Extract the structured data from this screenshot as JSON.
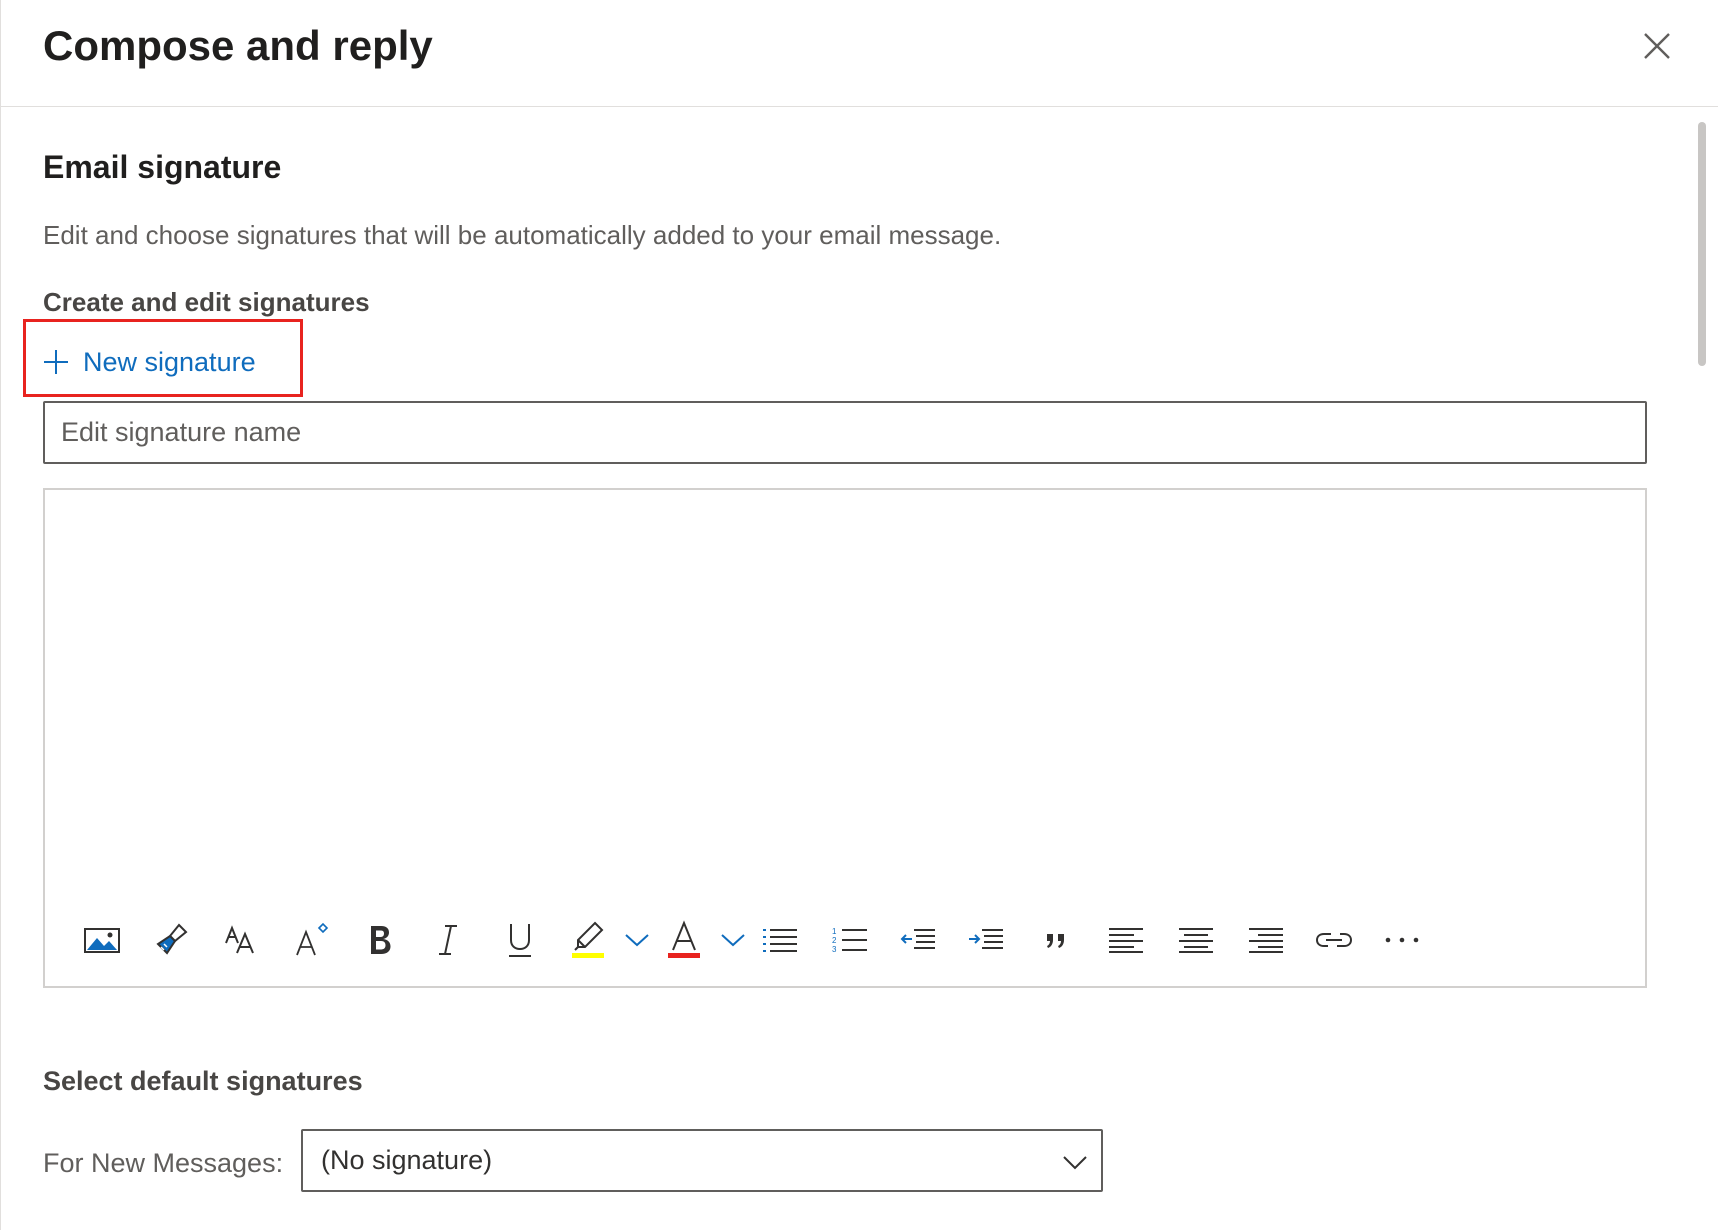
{
  "header": {
    "title": "Compose and reply",
    "close_icon": "close-icon"
  },
  "email_signature": {
    "title": "Email signature",
    "description": "Edit and choose signatures that will be automatically added to your email message.",
    "create_edit_label": "Create and edit signatures",
    "new_signature_label": "New signature",
    "highlight_color": "#e8231f",
    "name_placeholder": "Edit signature name",
    "name_value": ""
  },
  "toolbar": {
    "buttons": [
      {
        "name": "insert-picture-icon"
      },
      {
        "name": "format-painter-icon"
      },
      {
        "name": "font-size-icon"
      },
      {
        "name": "grow-font-icon"
      },
      {
        "name": "bold-icon"
      },
      {
        "name": "italic-icon"
      },
      {
        "name": "underline-icon"
      },
      {
        "name": "highlight-icon",
        "color": "#ffff00"
      },
      {
        "name": "font-color-icon",
        "color": "#e8231f"
      },
      {
        "name": "bullets-icon"
      },
      {
        "name": "numbering-icon"
      },
      {
        "name": "decrease-indent-icon"
      },
      {
        "name": "increase-indent-icon"
      },
      {
        "name": "quote-icon"
      },
      {
        "name": "align-left-icon"
      },
      {
        "name": "align-center-icon"
      },
      {
        "name": "align-right-icon"
      },
      {
        "name": "link-icon"
      },
      {
        "name": "more-options-icon"
      }
    ]
  },
  "defaults": {
    "title": "Select default signatures",
    "for_new_messages_label": "For New Messages:",
    "for_new_messages_value": "(No signature)"
  },
  "colors": {
    "accent": "#0f6cbd",
    "text_primary": "#201f1e",
    "text_secondary": "#605e5c"
  }
}
